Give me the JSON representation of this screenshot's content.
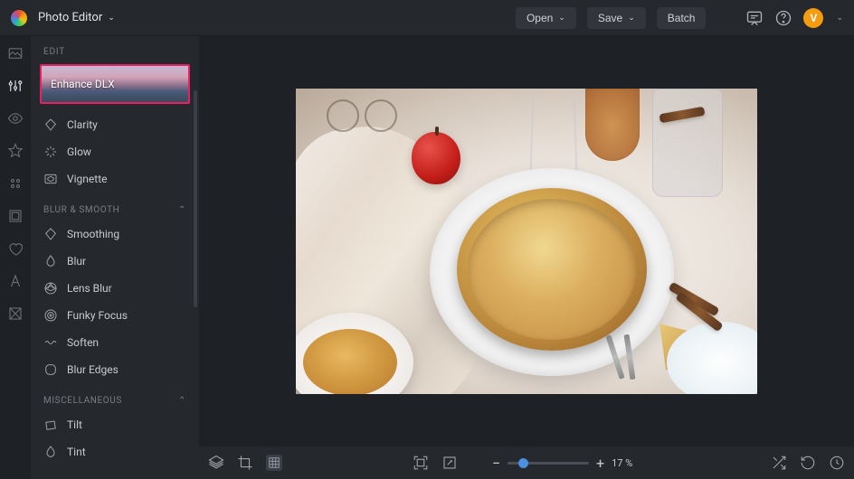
{
  "header": {
    "app_title": "Photo Editor",
    "open_label": "Open",
    "save_label": "Save",
    "batch_label": "Batch",
    "avatar_initial": "V"
  },
  "panel": {
    "head": "EDIT",
    "enhance_label": "Enhance DLX",
    "tools": [
      {
        "id": "clarity",
        "label": "Clarity",
        "icon": "diamond"
      },
      {
        "id": "glow",
        "label": "Glow",
        "icon": "sparkle"
      },
      {
        "id": "vignette",
        "label": "Vignette",
        "icon": "vignette"
      }
    ]
  },
  "sections": {
    "blur_label": "BLUR & SMOOTH",
    "blur_tools": [
      {
        "id": "smoothing",
        "label": "Smoothing",
        "icon": "diamond"
      },
      {
        "id": "blur",
        "label": "Blur",
        "icon": "drop"
      },
      {
        "id": "lens-blur",
        "label": "Lens Blur",
        "icon": "aperture"
      },
      {
        "id": "funky-focus",
        "label": "Funky Focus",
        "icon": "target"
      },
      {
        "id": "soften",
        "label": "Soften",
        "icon": "wave"
      },
      {
        "id": "blur-edges",
        "label": "Blur Edges",
        "icon": "square-round"
      }
    ],
    "misc_label": "MISCELLANEOUS",
    "misc_tools": [
      {
        "id": "tilt",
        "label": "Tilt",
        "icon": "tilt"
      },
      {
        "id": "tint",
        "label": "Tint",
        "icon": "drop"
      }
    ]
  },
  "bottombar": {
    "zoom_display": "17 %",
    "zoom_value": 17
  }
}
